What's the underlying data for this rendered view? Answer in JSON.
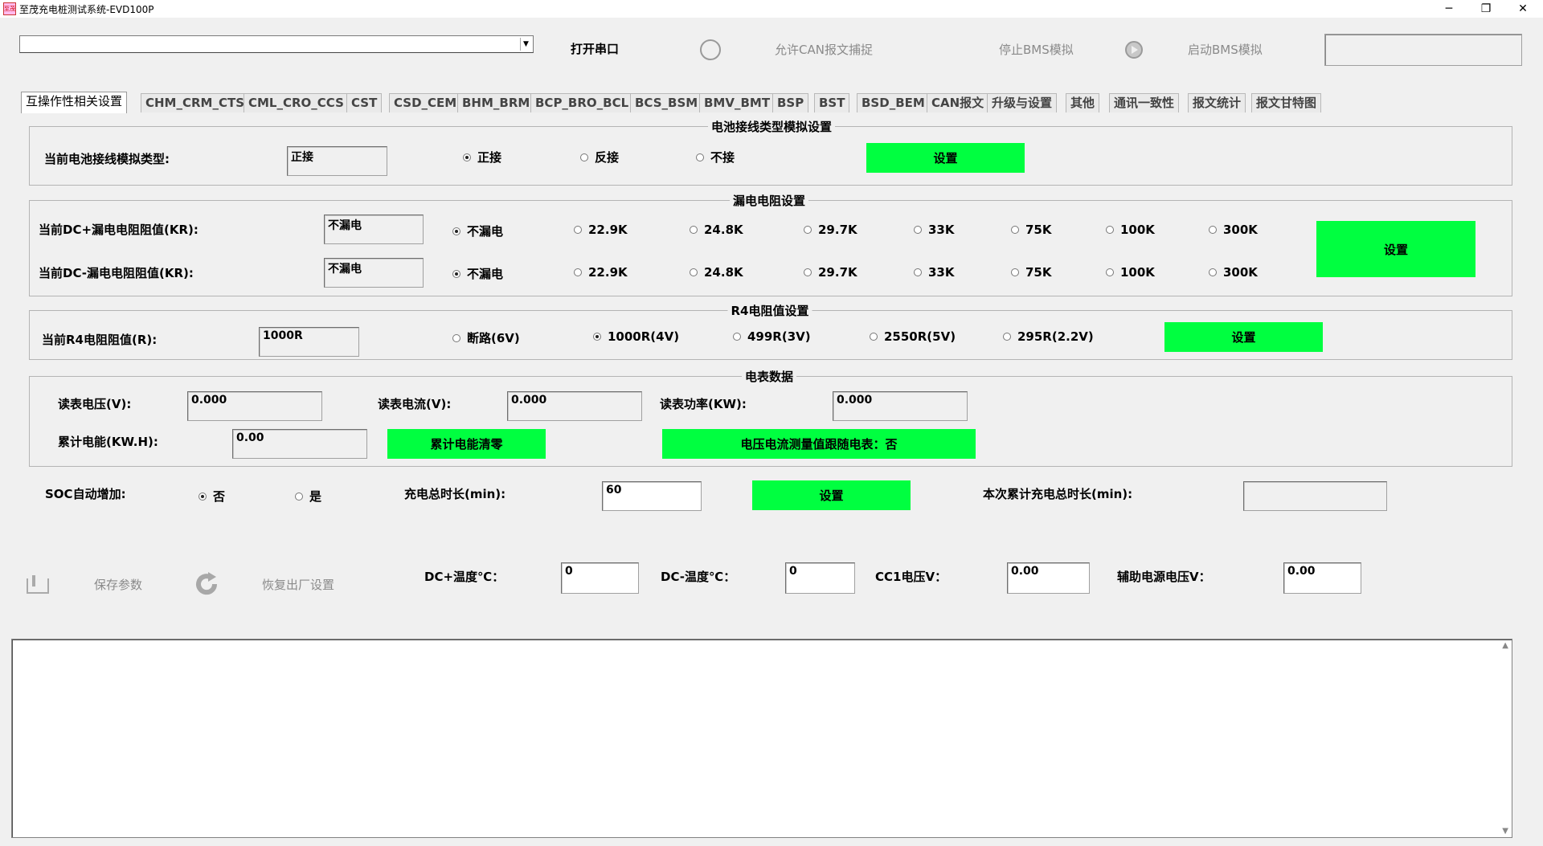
{
  "window": {
    "title": "至茂充电桩测试系统-EVD100P",
    "icon_text": "至茂",
    "controls": [
      "─",
      "❐",
      "✕"
    ]
  },
  "toolbar": {
    "port_combo_value": "",
    "open_port": "打开串口",
    "allow_can_capture": "允许CAN报文捕捉",
    "stop_bms_sim": "停止BMS模拟",
    "start_bms_sim": "启动BMS模拟",
    "status_box_value": ""
  },
  "tabs": [
    "互操作性相关设置",
    "CHM_CRM_CTS",
    "CML_CRO_CCS",
    "CST",
    "CSD_CEM",
    "BHM_BRM",
    "BCP_BRO_BCL",
    "BCS_BSM",
    "BMV_BMT",
    "BSP",
    "BST",
    "BSD_BEM",
    "CAN报文",
    "升级与设置",
    "其他",
    "通讯一致性",
    "报文统计",
    "报文甘特图"
  ],
  "battery_wiring": {
    "title": "电池接线类型模拟设置",
    "label": "当前电池接线模拟类型:",
    "value": "正接",
    "options": [
      "正接",
      "反接",
      "不接"
    ],
    "selected": 0,
    "set_button": "设置"
  },
  "leakage": {
    "title": "漏电电阻设置",
    "dc_plus_label": "当前DC+漏电电阻阻值(KR):",
    "dc_plus_value": "不漏电",
    "dc_minus_label": "当前DC-漏电电阻阻值(KR):",
    "dc_minus_value": "不漏电",
    "options": [
      "不漏电",
      "22.9K",
      "24.8K",
      "29.7K",
      "33K",
      "75K",
      "100K",
      "300K"
    ],
    "selected_plus": 0,
    "selected_minus": 0,
    "set_button": "设置"
  },
  "r4": {
    "title": "R4电阻值设置",
    "label": "当前R4电阻阻值(R):",
    "value": "1000R",
    "options": [
      "断路(6V)",
      "1000R(4V)",
      "499R(3V)",
      "2550R(5V)",
      "295R(2.2V)"
    ],
    "selected": 1,
    "set_button": "设置"
  },
  "meter": {
    "title": "电表数据",
    "voltage_label": "读表电压(V):",
    "voltage_value": "0.000",
    "current_label": "读表电流(V):",
    "current_value": "0.000",
    "power_label": "读表功率(KW):",
    "power_value": "0.000",
    "energy_label": "累计电能(KW.H):",
    "energy_value": "0.00",
    "clear_energy_button": "累计电能清零",
    "follow_meter_button": "电压电流测量值跟随电表：否"
  },
  "soc": {
    "label": "SOC自动增加:",
    "options": [
      "否",
      "是"
    ],
    "selected": 0,
    "total_time_label": "充电总时长(min):",
    "total_time_value": "60",
    "set_button": "设置",
    "accum_time_label": "本次累计充电总时长(min):",
    "accum_time_value": ""
  },
  "bottom": {
    "save_params": "保存参数",
    "restore_factory": "恢复出厂设置",
    "dc_plus_temp_label": "DC+温度℃：",
    "dc_plus_temp_value": "0",
    "dc_minus_temp_label": "DC-温度℃：",
    "dc_minus_temp_value": "0",
    "cc1_label": "CC1电压V：",
    "cc1_value": "0.00",
    "aux_label": "辅助电源电压V：",
    "aux_value": "0.00"
  },
  "log": {
    "content": ""
  },
  "colors": {
    "green_button": "#00ff40",
    "background": "#f0f0f0"
  }
}
